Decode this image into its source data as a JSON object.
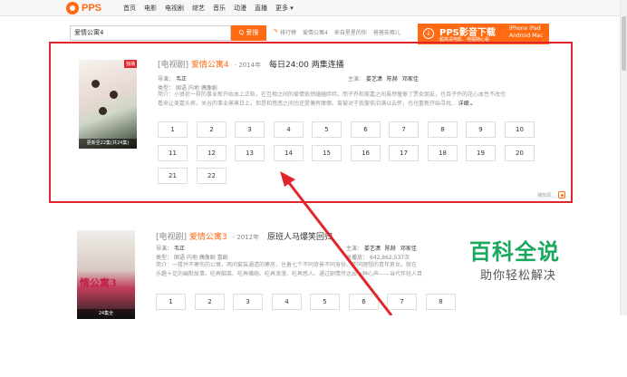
{
  "header": {
    "logo_text": "PPS",
    "nav": [
      "首页",
      "电影",
      "电视剧",
      "综艺",
      "音乐",
      "动漫",
      "直播",
      "更多 ▾"
    ]
  },
  "search": {
    "query": "爱情公寓4",
    "button_label": "Q 爱搜",
    "quick_links": [
      "排行榜",
      "爱情公寓4",
      "来自星星的你",
      "爸爸去哪儿"
    ]
  },
  "download": {
    "title": "PPS影音下载",
    "subtitle": "超高清电影、电视随心看",
    "platforms": [
      "iPhone iPad",
      "Android Mac"
    ]
  },
  "results": [
    {
      "tag": "[电视剧]",
      "name": "爱情公寓4",
      "year": "- 2014年",
      "update": "每日24:00 两集连播",
      "director_label": "导演：",
      "director": "韦正",
      "cast_label": "主演：",
      "cast": [
        "娄艺潇",
        "陈赫",
        "邓家佳"
      ],
      "genre_label": "类型：",
      "genre": "国语 内地 偶像剧",
      "desc_label": "简介：",
      "description": "小贤初一样的事业新开始本上正轨，在互相之间的爱情依然磕磕绊绊。而子乔和美嘉之间虽然憧憬了贾女朋友，也且子乔的花心本性不改也",
      "description2": "看来让美嘉头疼。关谷的事业蒸蒸日上，但是和悠悠之间也还是偶有摩擦。曾被对于我娶依旧满以云怀，也也重新开始寻找...",
      "more_label": "详细",
      "poster_badge": "独播",
      "poster_caption": "更新至22集(共24集)",
      "episodes": [
        "1",
        "2",
        "3",
        "4",
        "5",
        "6",
        "7",
        "8",
        "9",
        "10",
        "11",
        "12",
        "13",
        "14",
        "15",
        "16",
        "17",
        "18",
        "19",
        "20",
        "21",
        "22"
      ],
      "source_label": "播放源："
    },
    {
      "tag": "[电视剧]",
      "name": "爱情公寓3",
      "year": "- 2012年",
      "update": "原班人马爆笑回归",
      "director_label": "导演：",
      "director": "韦正",
      "cast_label": "主演：",
      "cast": [
        "娄艺潇",
        "陈赫",
        "邓家佳"
      ],
      "genre_label": "类型：",
      "genre": "国语 内地 偶像剧 喜剧",
      "plays_label": "总播放：",
      "plays": "642,862,537次",
      "desc_label": "简介：",
      "description": "一楼并不寒伤的公寓，两间套装通透的寒房，住着七个不同背景不同身份、不同理想的青年男女。就在",
      "description2": "乐趣十足的幽默故事。吃再脑菜、吃再嘴砲、吃再浪漫、吃再感人。通过剧情传达出一种心声——当代年轻人目",
      "poster_title": "情公寓3",
      "poster_caption": "24集全"
    }
  ],
  "watermark": {
    "brand": "百科全说",
    "slogan": "助你轻松解决"
  },
  "colors": {
    "accent": "#ff6a13",
    "highlight_border": "#e0262b",
    "annotation_arrow": "#e0262b",
    "watermark_green": "#1aa85f"
  }
}
